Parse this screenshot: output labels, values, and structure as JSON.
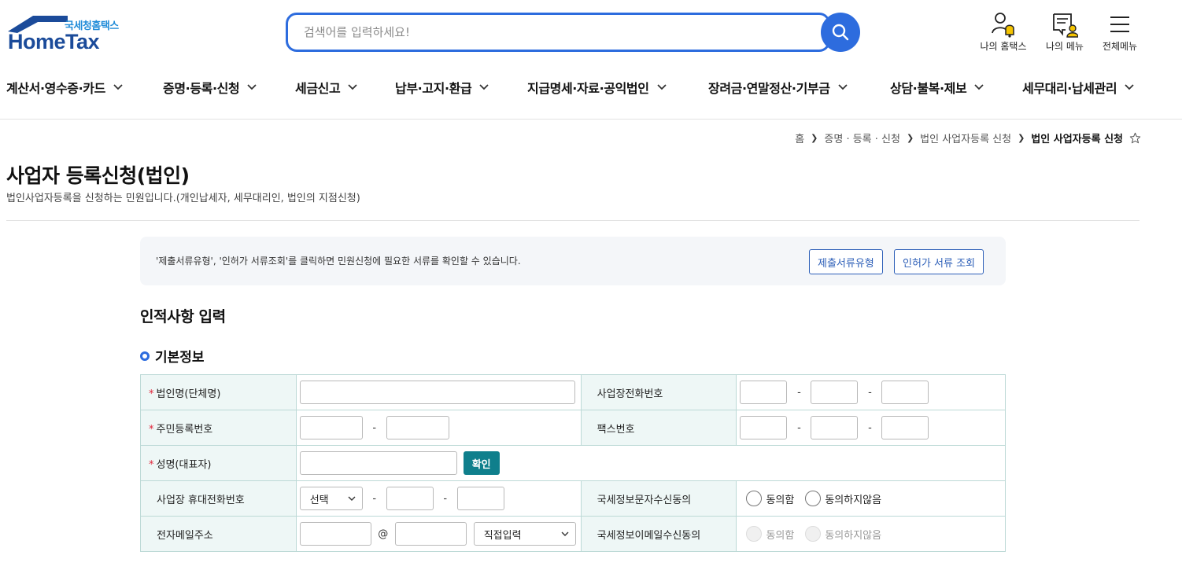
{
  "header": {
    "logo_sub": "국세청홈택스",
    "logo_main": "HomeTax",
    "search_placeholder": "검색어를 입력하세요!",
    "util": [
      "나의 홈택스",
      "나의 메뉴",
      "전체메뉴"
    ]
  },
  "gnb": [
    "계산서·영수증·카드",
    "증명·등록·신청",
    "세금신고",
    "납부·고지·환급",
    "지급명세·자료·공익법인",
    "장려금·연말정산·기부금",
    "상담·불복·제보",
    "세무대리·납세관리"
  ],
  "breadcrumb": [
    "홈",
    "증명 · 등록 · 신청",
    "법인 사업자등록 신청",
    "법인 사업자등록 신청"
  ],
  "page": {
    "title": "사업자 등록신청(법인)",
    "desc": "법인사업자등록을 신청하는 민원입니다.(개인납세자, 세무대리인, 법인의 지점신청)"
  },
  "notice": {
    "text": "'제출서류유형', '인허가 서류조회'를 클릭하면 민원신청에 필요한 서류를 확인할 수 있습니다.",
    "btn1": "제출서류유형",
    "btn2": "인허가 서류 조회"
  },
  "section_title": "인적사항 입력",
  "subsection_title": "기본정보",
  "form": {
    "req_mark": "*",
    "corp_name": "법인명(단체명)",
    "biz_phone": "사업장전화번호",
    "resident_no": "주민등록번호",
    "fax": "팩스번호",
    "rep_name": "성명(대표자)",
    "confirm_btn": "확인",
    "mobile": "사업장 휴대전화번호",
    "mobile_select": "선택",
    "sms_consent": "국세정보문자수신동의",
    "agree": "동의함",
    "disagree": "동의하지않음",
    "email": "전자메일주소",
    "at": "@",
    "email_domain_select": "직접입력",
    "email_consent": "국세정보이메일수신동의",
    "dash": "-"
  }
}
